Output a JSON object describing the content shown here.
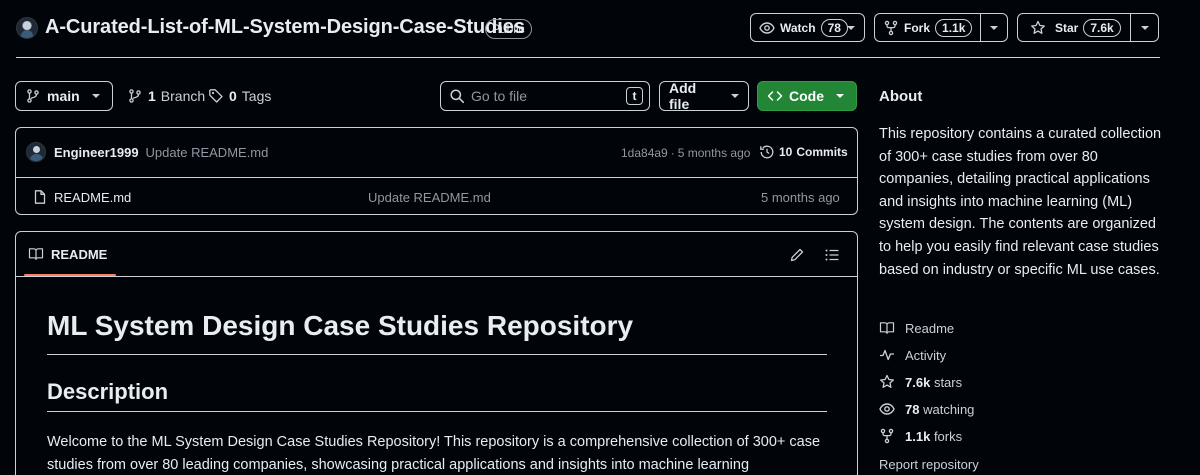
{
  "repo": {
    "name": "A-Curated-List-of-ML-System-Design-Case-Studies",
    "visibility": "Public"
  },
  "actions": {
    "watch_label": "Watch",
    "watch_count": "78",
    "fork_label": "Fork",
    "fork_count": "1.1k",
    "star_label": "Star",
    "star_count": "7.6k"
  },
  "toolbar": {
    "branch": "main",
    "branches_count": "1",
    "branches_label": "Branch",
    "tags_count": "0",
    "tags_label": "Tags",
    "search_placeholder": "Go to file",
    "search_shortcut": "t",
    "add_file": "Add file",
    "code": "Code"
  },
  "latest_commit": {
    "author": "Engineer1999",
    "message": "Update README.md",
    "sha": "1da84a9",
    "separator": "·",
    "time": "5 months ago",
    "commits_count": "10",
    "commits_label": "Commits"
  },
  "files": [
    {
      "name": "README.md",
      "message": "Update README.md",
      "time": "5 months ago"
    }
  ],
  "readme": {
    "tab_label": "README",
    "h1": "ML System Design Case Studies Repository",
    "h2": "Description",
    "paragraph": "Welcome to the ML System Design Case Studies Repository! This repository is a comprehensive collection of 300+ case studies from over 80 leading companies, showcasing practical applications and insights into machine learning"
  },
  "about": {
    "title": "About",
    "description": "This repository contains a curated collection of 300+ case studies from over 80 companies, detailing practical applications and insights into machine learning (ML) system design. The contents are organized to help you easily find relevant case studies based on industry or specific ML use cases.",
    "links": {
      "readme": "Readme",
      "activity": "Activity",
      "stars_count": "7.6k",
      "stars_label": "stars",
      "watching_count": "78",
      "watching_label": "watching",
      "forks_count": "1.1k",
      "forks_label": "forks",
      "report": "Report repository"
    }
  },
  "icons": {
    "avatar": "avatar",
    "branch": "git-branch-icon",
    "tag": "tag-icon",
    "search": "search-icon",
    "code": "code-icon",
    "history": "history-icon",
    "file": "file-icon",
    "book": "book-icon",
    "pencil": "pencil-icon",
    "list": "list-unordered-icon",
    "eye": "eye-icon",
    "fork": "repo-forked-icon",
    "star": "star-icon",
    "pulse": "pulse-icon"
  },
  "colors": {
    "background": "#010409",
    "text": "#e6edf3",
    "muted": "#9198a1",
    "border": "#c9d1d9",
    "code_button": "#238636",
    "readme_accent": "#f78166"
  }
}
